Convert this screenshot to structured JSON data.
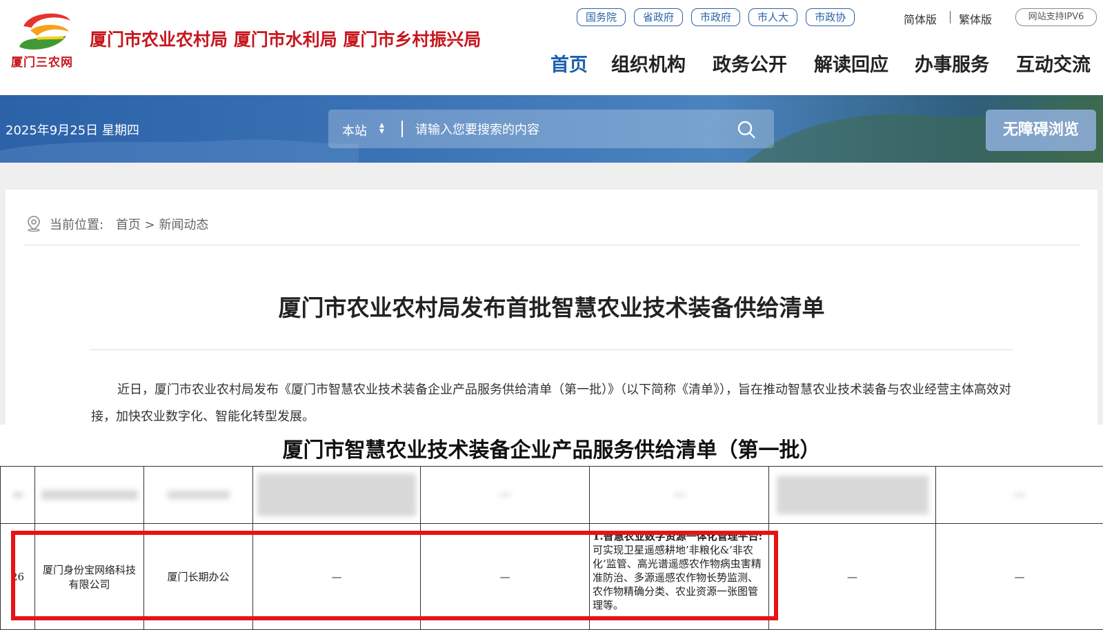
{
  "header": {
    "logo_text": "厦门三农网",
    "agencies": "厦门市农业农村局 厦门市水利局 厦门市乡村振兴局",
    "top_links": [
      "国务院",
      "省政府",
      "市政府",
      "市人大",
      "市政协"
    ],
    "version_simplified": "简体版",
    "version_traditional": "繁体版",
    "ipv6": "网站支持IPV6",
    "nav": [
      "首页",
      "组织机构",
      "政务公开",
      "解读回应",
      "办事服务",
      "互动交流"
    ],
    "accent_color": "#1c5fae",
    "brand_red": "#c7161d"
  },
  "banner": {
    "date": "2025年9月25日 星期四",
    "scope": "本站",
    "search_placeholder": "请输入您要搜索的内容",
    "accessibility": "无障碍浏览"
  },
  "breadcrumb": {
    "label": "当前位置:",
    "home": "首页",
    "sep": ">",
    "current": "新闻动态"
  },
  "article": {
    "title": "厦门市农业农村局发布首批智慧农业技术装备供给清单",
    "paragraph": "近日，厦门市农业农村局发布《厦门市智慧农业技术装备企业产品服务供给清单（第一批）》（以下简称《清单》），旨在推动智慧农业技术装备与农业经营主体高效对接，加快农业数字化、智能化转型发展。"
  },
  "table": {
    "title": "厦门市智慧农业技术装备企业产品服务供给清单（第一批）",
    "row": {
      "no": "26",
      "company": "厦门身份宝网络科技有限公司",
      "office": "厦门长期办公",
      "col4": "—",
      "col5": "—",
      "product_bold": "1.智慧农业数字资源一体化管理平台:",
      "product_text": "可实现卫星遥感耕地’非粮化&’非农化’监管、高光谱遥感农作物病虫害精准防治、多源遥感农作物长势监测、农作物精确分类、农业资源一张图管理等。",
      "col7": "—",
      "col8": "—"
    },
    "highlight_color": "#e81212"
  }
}
